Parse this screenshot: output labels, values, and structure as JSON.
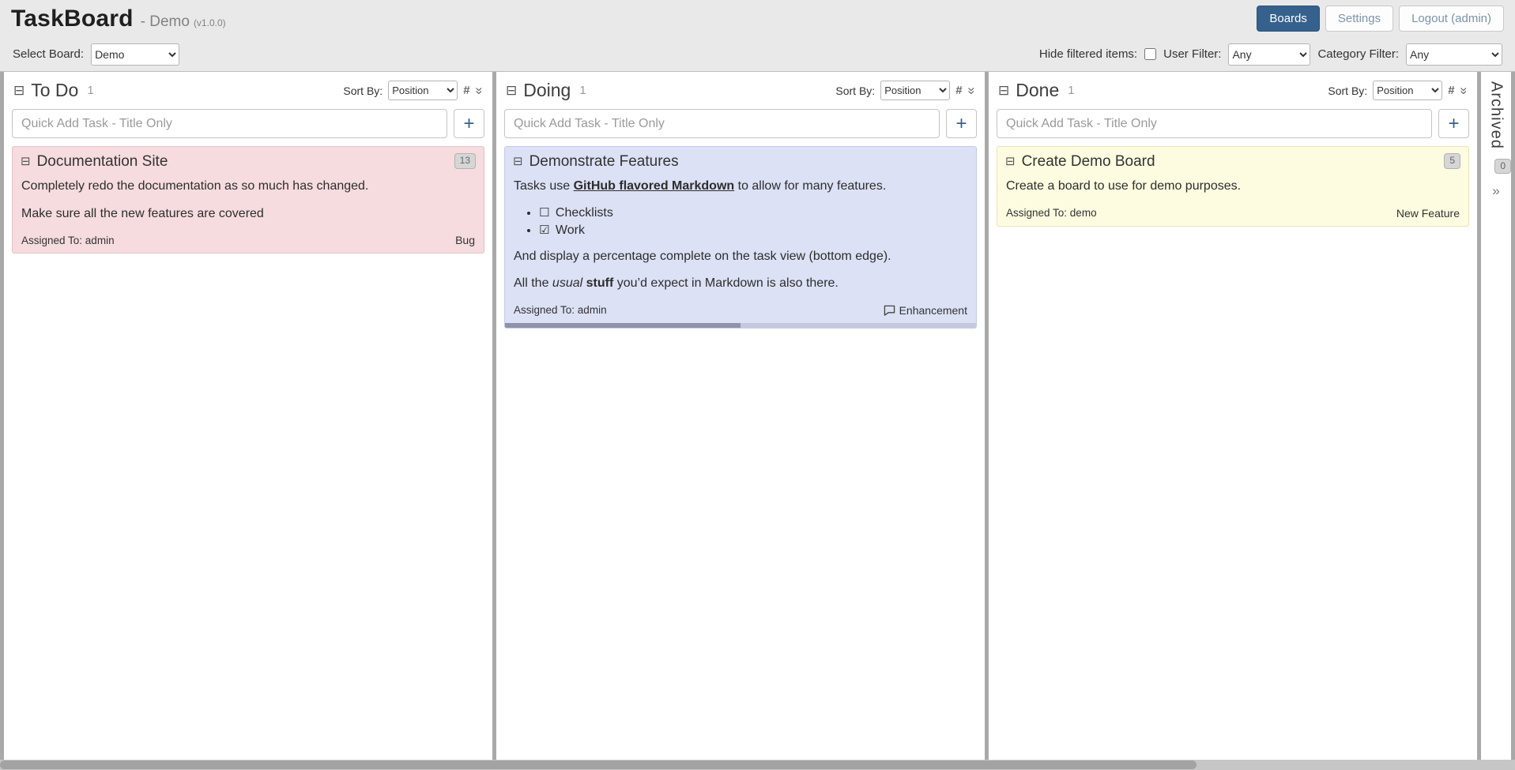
{
  "header": {
    "app_title": "TaskBoard",
    "board_suffix": "- Demo",
    "version": "(v1.0.0)",
    "boards_button": "Boards",
    "settings_button": "Settings",
    "logout_button": "Logout (admin)"
  },
  "toolbar": {
    "select_board_label": "Select Board:",
    "select_board_value": "Demo",
    "hide_filtered_label": "Hide filtered items:",
    "hide_filtered_checked": false,
    "user_filter_label": "User Filter:",
    "user_filter_value": "Any",
    "category_filter_label": "Category Filter:",
    "category_filter_value": "Any"
  },
  "board": {
    "sort_by_label": "Sort By:",
    "sort_by_value": "Position",
    "quick_add_placeholder": "Quick Add Task - Title Only"
  },
  "icons": {
    "collapse": "⊟",
    "add": "+",
    "hash": "#",
    "double_chevron": "»",
    "expand_archived": "»"
  },
  "colors": {
    "accent": "#35618C",
    "todo_card_bg": "#F6DCDE",
    "doing_card_bg": "#DCE1F5",
    "done_card_bg": "#FDFBE0",
    "header_bg": "#E9E9E9"
  },
  "columns": [
    {
      "title": "To Do",
      "count": "1",
      "tasks": [
        {
          "title": "Documentation Site",
          "points": "13",
          "style": "background:#F6DCDE;border-color:#E3C2C6",
          "paragraphs": [
            "Completely redo the documentation as so much has changed.",
            "Make sure all the new features are covered"
          ],
          "assigned": "Assigned To: admin",
          "category": "Bug"
        }
      ]
    },
    {
      "title": "Doing",
      "count": "1",
      "tasks": [
        {
          "title": "Demonstrate Features",
          "style": "background:#DCE1F5;border-color:#C2CBEC",
          "p1_pre": "Tasks use ",
          "p1_link": "GitHub flavored Markdown",
          "p1_post": " to allow for many features.",
          "checklist": [
            {
              "box": "☐",
              "label": "Checklists",
              "checked": false
            },
            {
              "box": "☑",
              "label": "Work",
              "checked": true
            }
          ],
          "p2": "And display a percentage complete on the task view (bottom edge).",
          "p3_pre": "All the ",
          "p3_italic": "usual",
          "p3_bold": "stuff",
          "p3_post": " you’d expect in Markdown is also there.",
          "assigned": "Assigned To: admin",
          "category": "Enhancement",
          "progress_percent": 50,
          "progress_style": "width:50%"
        }
      ]
    },
    {
      "title": "Done",
      "count": "1",
      "tasks": [
        {
          "title": "Create Demo Board",
          "points": "5",
          "style": "background:#FDFBE0;border-color:#EAE4B8",
          "paragraphs": [
            "Create a board to use for demo purposes."
          ],
          "assigned": "Assigned To: demo",
          "category": "New Feature"
        }
      ]
    }
  ],
  "archived": {
    "label": "Archived",
    "count": "0"
  }
}
